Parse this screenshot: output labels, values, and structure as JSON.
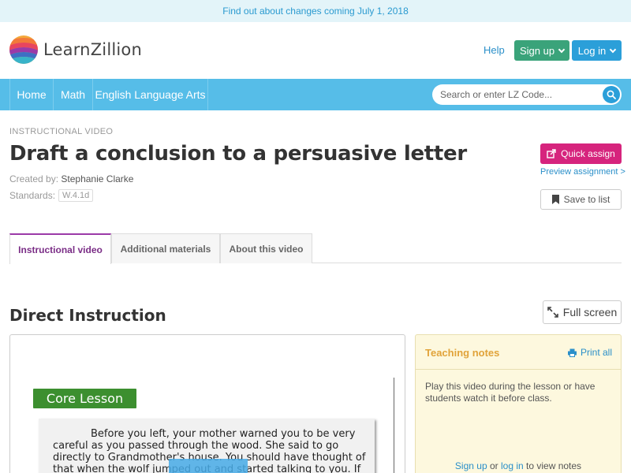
{
  "banner": {
    "text": "Find out about changes coming July 1, 2018"
  },
  "header": {
    "logo_text": "LearnZillion",
    "help": "Help",
    "signup": "Sign up",
    "login": "Log in"
  },
  "nav": {
    "items": [
      {
        "label": "Home"
      },
      {
        "label": "Math"
      },
      {
        "label": "English Language Arts"
      }
    ],
    "search_placeholder": "Search or enter LZ Code..."
  },
  "lesson": {
    "eyebrow": "INSTRUCTIONAL VIDEO",
    "title": "Draft a conclusion to a persuasive letter",
    "created_by_label": "Created by:",
    "created_by": "Stephanie Clarke",
    "standards_label": "Standards:",
    "standard": "W.4.1d"
  },
  "actions": {
    "quick_assign": "Quick assign",
    "preview": "Preview assignment >",
    "save": "Save to list"
  },
  "tabs": [
    {
      "label": "Instructional video",
      "active": true
    },
    {
      "label": "Additional materials",
      "active": false
    },
    {
      "label": "About this video",
      "active": false
    }
  ],
  "section": {
    "title": "Direct Instruction",
    "full_screen": "Full screen"
  },
  "video": {
    "badge": "Core Lesson",
    "text": "Before you left, your mother warned you to be very careful as you passed through the wood. She said to go directly to Grandmother's house. You should have thought of that when the wolf jumped out and started talking to you. If you"
  },
  "notes": {
    "title": "Teaching notes",
    "print": "Print all",
    "body": "Play this video during the lesson or have students watch it before class.",
    "signup": "Sign up",
    "or": "or",
    "login": "log in",
    "suffix": "to view notes"
  },
  "colors": {
    "nav": "#56bde8",
    "signup": "#3aa37a",
    "login": "#2b9fd9",
    "quick_assign": "#d6247d",
    "core_badge": "#3c8f2f",
    "notes_bg": "#fdf8de",
    "notes_title": "#e1a33a"
  }
}
